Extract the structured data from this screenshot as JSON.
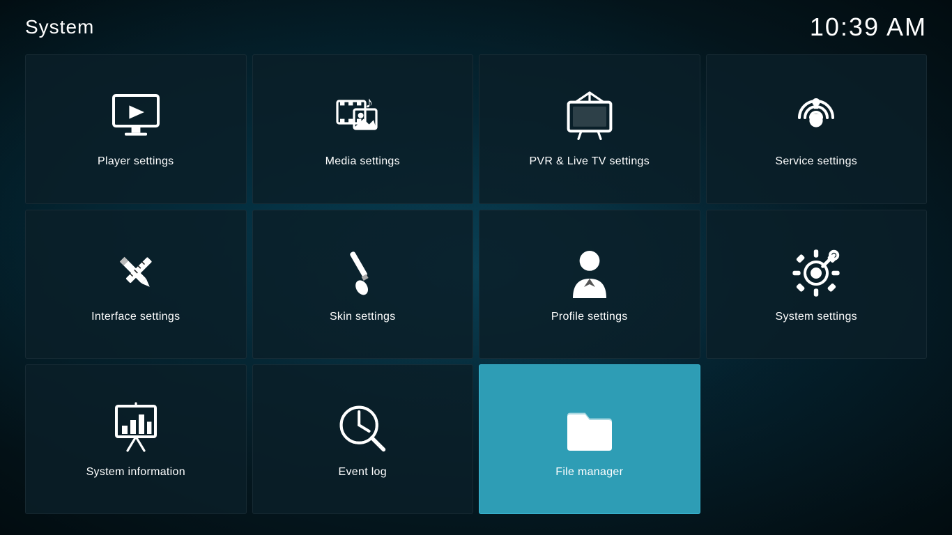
{
  "header": {
    "title": "System",
    "clock": "10:39 AM"
  },
  "tiles": [
    {
      "id": "player-settings",
      "label": "Player settings",
      "icon": "player",
      "active": false
    },
    {
      "id": "media-settings",
      "label": "Media settings",
      "icon": "media",
      "active": false
    },
    {
      "id": "pvr-settings",
      "label": "PVR & Live TV settings",
      "icon": "pvr",
      "active": false
    },
    {
      "id": "service-settings",
      "label": "Service settings",
      "icon": "service",
      "active": false
    },
    {
      "id": "interface-settings",
      "label": "Interface settings",
      "icon": "interface",
      "active": false
    },
    {
      "id": "skin-settings",
      "label": "Skin settings",
      "icon": "skin",
      "active": false
    },
    {
      "id": "profile-settings",
      "label": "Profile settings",
      "icon": "profile",
      "active": false
    },
    {
      "id": "system-settings",
      "label": "System settings",
      "icon": "system",
      "active": false
    },
    {
      "id": "system-information",
      "label": "System information",
      "icon": "sysinfo",
      "active": false
    },
    {
      "id": "event-log",
      "label": "Event log",
      "icon": "eventlog",
      "active": false
    },
    {
      "id": "file-manager",
      "label": "File manager",
      "icon": "filemanager",
      "active": true
    }
  ]
}
